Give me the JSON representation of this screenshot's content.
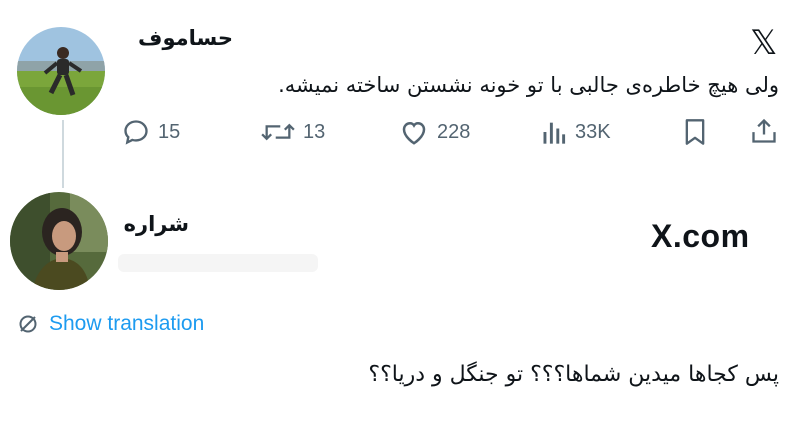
{
  "tweet": {
    "author_name": "حساموف",
    "text": "ولی هیچ خاطره‌ی جالبی با تو خونه نشستن ساخته نمیشه.",
    "metrics": {
      "replies": "15",
      "retweets": "13",
      "likes": "228",
      "views": "33K"
    }
  },
  "reply": {
    "author_name": "شراره",
    "translate_label": "Show translation",
    "text": "پس کجاها میدین شماها؟؟؟ تو جنگل و دریا؟؟"
  },
  "watermark": "X.com",
  "colors": {
    "accent": "#1d9bf0",
    "muted": "#536471",
    "text": "#0f1419"
  }
}
